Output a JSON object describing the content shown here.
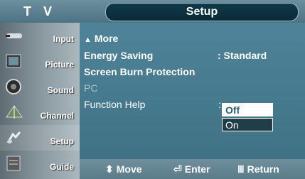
{
  "header": {
    "tv_label": "T V",
    "title": "Setup"
  },
  "sidebar": {
    "items": [
      {
        "label": "Input",
        "icon": "input-icon"
      },
      {
        "label": "Picture",
        "icon": "picture-icon"
      },
      {
        "label": "Sound",
        "icon": "sound-icon"
      },
      {
        "label": "Channel",
        "icon": "channel-icon"
      },
      {
        "label": "Setup",
        "icon": "setup-icon"
      },
      {
        "label": "Guide",
        "icon": "guide-icon"
      }
    ]
  },
  "menu": {
    "more": "More",
    "energy_saving": {
      "label": "Energy Saving",
      "value": ": Standard"
    },
    "screen_burn": "Screen Burn Protection",
    "pc": "PC",
    "function_help": {
      "label": "Function Help",
      "colon": ":"
    }
  },
  "dropdown": {
    "options": [
      "Off",
      "On"
    ],
    "selected": "Off"
  },
  "footer": {
    "move": "Move",
    "enter": "Enter",
    "return": "Return"
  },
  "colors": {
    "accent": "#3f7388",
    "selected_bg": "#ffffff",
    "disabled_text": "#a9c2cc"
  }
}
